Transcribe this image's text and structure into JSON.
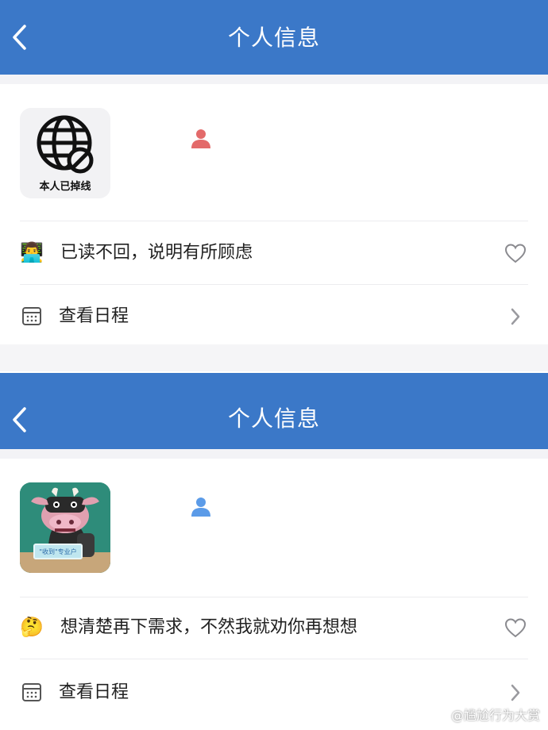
{
  "colors": {
    "navbar": "#3b78c8",
    "person_red": "#e36a6a",
    "person_blue": "#5b9be8"
  },
  "screens": [
    {
      "nav_title": "个人信息",
      "avatar_caption": "本人已掉线",
      "avatar_icon": "globe-offline-icon",
      "status_emoji": "👨‍💻",
      "status_text": "已读不回，说明有所顾虑",
      "schedule_label": "查看日程"
    },
    {
      "nav_title": "个人信息",
      "avatar_icon": "cow-avatar-icon",
      "avatar_sign": "\"收到\"专业户",
      "status_emoji": "🤔",
      "status_text": "想清楚再下需求，不然我就劝你再想想",
      "schedule_label": "查看日程"
    }
  ],
  "watermark": "@尴尬行为大赏"
}
